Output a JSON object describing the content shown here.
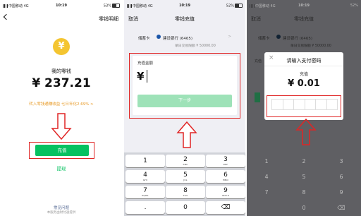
{
  "panel1": {
    "status": {
      "carrier": "中国移动 4G",
      "time": "10:19",
      "battery": "53%"
    },
    "nav_right": "零钱明细",
    "title": "我的零钱",
    "amount": "¥ 237.21",
    "promo": "转入零钱通赚收益 七日年化2.69% >",
    "topup_button": "充值",
    "withdraw_link": "提现",
    "faq_link": "常见问题",
    "footer_text": "本服务由财付通提供"
  },
  "panel2": {
    "status": {
      "carrier": "中国移动 4G",
      "time": "10:19",
      "battery": "52%"
    },
    "nav_left": "取消",
    "nav_title": "零钱充值",
    "card_label": "储蓄卡",
    "bank_name": "建设银行 (6465)",
    "limit": "单日交易限额 ¥ 50000.00",
    "amount_label": "充值金额",
    "currency": "¥",
    "next_button": "下一步",
    "keys": [
      {
        "num": "1",
        "sub": ""
      },
      {
        "num": "2",
        "sub": "ABC"
      },
      {
        "num": "3",
        "sub": "DEF"
      },
      {
        "num": "4",
        "sub": "GHI"
      },
      {
        "num": "5",
        "sub": "JKL"
      },
      {
        "num": "6",
        "sub": "MNO"
      },
      {
        "num": "7",
        "sub": "PQRS"
      },
      {
        "num": "8",
        "sub": "TUV"
      },
      {
        "num": "9",
        "sub": "WXYZ"
      },
      {
        "num": ".",
        "sub": ""
      },
      {
        "num": "0",
        "sub": ""
      },
      {
        "num": "⌫",
        "sub": ""
      }
    ]
  },
  "panel3": {
    "status": {
      "carrier": "中国移动 4G",
      "time": "10:19",
      "battery": "52%"
    },
    "nav_left": "取消",
    "nav_title": "零钱充值",
    "card_label": "储蓄卡",
    "bank_name": "建设银行 (6465)",
    "limit": "单日交易限额 ¥ 50000.00",
    "amount_label_partial": "充值",
    "dialog_title": "请输入支付密码",
    "dialog_subtitle": "充值",
    "dialog_amount": "¥ 0.01",
    "keys": [
      "1",
      "2",
      "3",
      "4",
      "5",
      "6",
      "7",
      "8",
      "9",
      "",
      "0",
      "⌫"
    ]
  },
  "colors": {
    "accent": "#07c160",
    "coin": "#f4c531",
    "red": "#e02525",
    "promo": "#e89c2a"
  }
}
